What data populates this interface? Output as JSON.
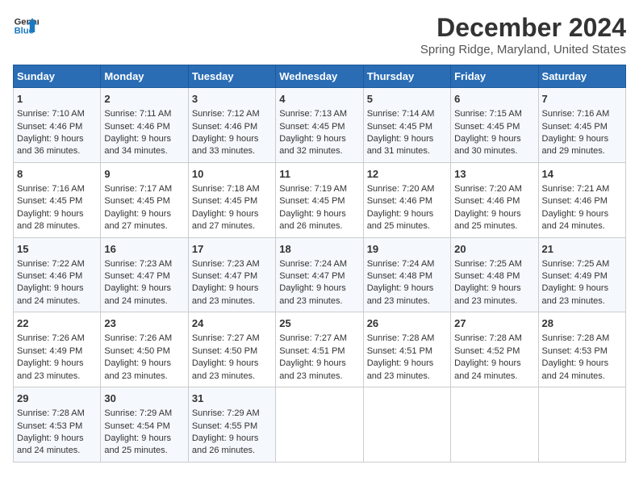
{
  "logo": {
    "line1": "General",
    "line2": "Blue"
  },
  "title": "December 2024",
  "subtitle": "Spring Ridge, Maryland, United States",
  "days_of_week": [
    "Sunday",
    "Monday",
    "Tuesday",
    "Wednesday",
    "Thursday",
    "Friday",
    "Saturday"
  ],
  "weeks": [
    [
      {
        "day": "1",
        "sunrise": "Sunrise: 7:10 AM",
        "sunset": "Sunset: 4:46 PM",
        "daylight": "Daylight: 9 hours and 36 minutes."
      },
      {
        "day": "2",
        "sunrise": "Sunrise: 7:11 AM",
        "sunset": "Sunset: 4:46 PM",
        "daylight": "Daylight: 9 hours and 34 minutes."
      },
      {
        "day": "3",
        "sunrise": "Sunrise: 7:12 AM",
        "sunset": "Sunset: 4:46 PM",
        "daylight": "Daylight: 9 hours and 33 minutes."
      },
      {
        "day": "4",
        "sunrise": "Sunrise: 7:13 AM",
        "sunset": "Sunset: 4:45 PM",
        "daylight": "Daylight: 9 hours and 32 minutes."
      },
      {
        "day": "5",
        "sunrise": "Sunrise: 7:14 AM",
        "sunset": "Sunset: 4:45 PM",
        "daylight": "Daylight: 9 hours and 31 minutes."
      },
      {
        "day": "6",
        "sunrise": "Sunrise: 7:15 AM",
        "sunset": "Sunset: 4:45 PM",
        "daylight": "Daylight: 9 hours and 30 minutes."
      },
      {
        "day": "7",
        "sunrise": "Sunrise: 7:16 AM",
        "sunset": "Sunset: 4:45 PM",
        "daylight": "Daylight: 9 hours and 29 minutes."
      }
    ],
    [
      {
        "day": "8",
        "sunrise": "Sunrise: 7:16 AM",
        "sunset": "Sunset: 4:45 PM",
        "daylight": "Daylight: 9 hours and 28 minutes."
      },
      {
        "day": "9",
        "sunrise": "Sunrise: 7:17 AM",
        "sunset": "Sunset: 4:45 PM",
        "daylight": "Daylight: 9 hours and 27 minutes."
      },
      {
        "day": "10",
        "sunrise": "Sunrise: 7:18 AM",
        "sunset": "Sunset: 4:45 PM",
        "daylight": "Daylight: 9 hours and 27 minutes."
      },
      {
        "day": "11",
        "sunrise": "Sunrise: 7:19 AM",
        "sunset": "Sunset: 4:45 PM",
        "daylight": "Daylight: 9 hours and 26 minutes."
      },
      {
        "day": "12",
        "sunrise": "Sunrise: 7:20 AM",
        "sunset": "Sunset: 4:46 PM",
        "daylight": "Daylight: 9 hours and 25 minutes."
      },
      {
        "day": "13",
        "sunrise": "Sunrise: 7:20 AM",
        "sunset": "Sunset: 4:46 PM",
        "daylight": "Daylight: 9 hours and 25 minutes."
      },
      {
        "day": "14",
        "sunrise": "Sunrise: 7:21 AM",
        "sunset": "Sunset: 4:46 PM",
        "daylight": "Daylight: 9 hours and 24 minutes."
      }
    ],
    [
      {
        "day": "15",
        "sunrise": "Sunrise: 7:22 AM",
        "sunset": "Sunset: 4:46 PM",
        "daylight": "Daylight: 9 hours and 24 minutes."
      },
      {
        "day": "16",
        "sunrise": "Sunrise: 7:23 AM",
        "sunset": "Sunset: 4:47 PM",
        "daylight": "Daylight: 9 hours and 24 minutes."
      },
      {
        "day": "17",
        "sunrise": "Sunrise: 7:23 AM",
        "sunset": "Sunset: 4:47 PM",
        "daylight": "Daylight: 9 hours and 23 minutes."
      },
      {
        "day": "18",
        "sunrise": "Sunrise: 7:24 AM",
        "sunset": "Sunset: 4:47 PM",
        "daylight": "Daylight: 9 hours and 23 minutes."
      },
      {
        "day": "19",
        "sunrise": "Sunrise: 7:24 AM",
        "sunset": "Sunset: 4:48 PM",
        "daylight": "Daylight: 9 hours and 23 minutes."
      },
      {
        "day": "20",
        "sunrise": "Sunrise: 7:25 AM",
        "sunset": "Sunset: 4:48 PM",
        "daylight": "Daylight: 9 hours and 23 minutes."
      },
      {
        "day": "21",
        "sunrise": "Sunrise: 7:25 AM",
        "sunset": "Sunset: 4:49 PM",
        "daylight": "Daylight: 9 hours and 23 minutes."
      }
    ],
    [
      {
        "day": "22",
        "sunrise": "Sunrise: 7:26 AM",
        "sunset": "Sunset: 4:49 PM",
        "daylight": "Daylight: 9 hours and 23 minutes."
      },
      {
        "day": "23",
        "sunrise": "Sunrise: 7:26 AM",
        "sunset": "Sunset: 4:50 PM",
        "daylight": "Daylight: 9 hours and 23 minutes."
      },
      {
        "day": "24",
        "sunrise": "Sunrise: 7:27 AM",
        "sunset": "Sunset: 4:50 PM",
        "daylight": "Daylight: 9 hours and 23 minutes."
      },
      {
        "day": "25",
        "sunrise": "Sunrise: 7:27 AM",
        "sunset": "Sunset: 4:51 PM",
        "daylight": "Daylight: 9 hours and 23 minutes."
      },
      {
        "day": "26",
        "sunrise": "Sunrise: 7:28 AM",
        "sunset": "Sunset: 4:51 PM",
        "daylight": "Daylight: 9 hours and 23 minutes."
      },
      {
        "day": "27",
        "sunrise": "Sunrise: 7:28 AM",
        "sunset": "Sunset: 4:52 PM",
        "daylight": "Daylight: 9 hours and 24 minutes."
      },
      {
        "day": "28",
        "sunrise": "Sunrise: 7:28 AM",
        "sunset": "Sunset: 4:53 PM",
        "daylight": "Daylight: 9 hours and 24 minutes."
      }
    ],
    [
      {
        "day": "29",
        "sunrise": "Sunrise: 7:28 AM",
        "sunset": "Sunset: 4:53 PM",
        "daylight": "Daylight: 9 hours and 24 minutes."
      },
      {
        "day": "30",
        "sunrise": "Sunrise: 7:29 AM",
        "sunset": "Sunset: 4:54 PM",
        "daylight": "Daylight: 9 hours and 25 minutes."
      },
      {
        "day": "31",
        "sunrise": "Sunrise: 7:29 AM",
        "sunset": "Sunset: 4:55 PM",
        "daylight": "Daylight: 9 hours and 26 minutes."
      },
      null,
      null,
      null,
      null
    ]
  ]
}
